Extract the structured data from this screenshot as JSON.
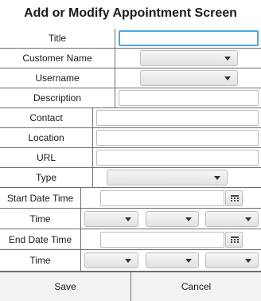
{
  "window": {
    "title": "Add or Modify Appointment Screen"
  },
  "form": {
    "title_label": "Title",
    "customer_label": "Customer Name",
    "username_label": "Username",
    "description_label": "Description",
    "contact_label": "Contact",
    "location_label": "Location",
    "url_label": "URL",
    "type_label": "Type",
    "start_label": "Start Date Time",
    "start_time_label": "Time",
    "end_label": "End Date Time",
    "end_time_label": "Time"
  },
  "fields": {
    "title": "",
    "description": "",
    "contact": "",
    "location": "",
    "url": "",
    "start_date": "",
    "end_date": ""
  },
  "buttons": {
    "save": "Save",
    "cancel": "Cancel"
  },
  "icons": {
    "calendar": "calendar-icon",
    "dropdown": "chevron-down-icon"
  },
  "colors": {
    "focus": "#4aa7e6",
    "border": "#6e6e6e",
    "button_bg": "#f2f2f2"
  }
}
